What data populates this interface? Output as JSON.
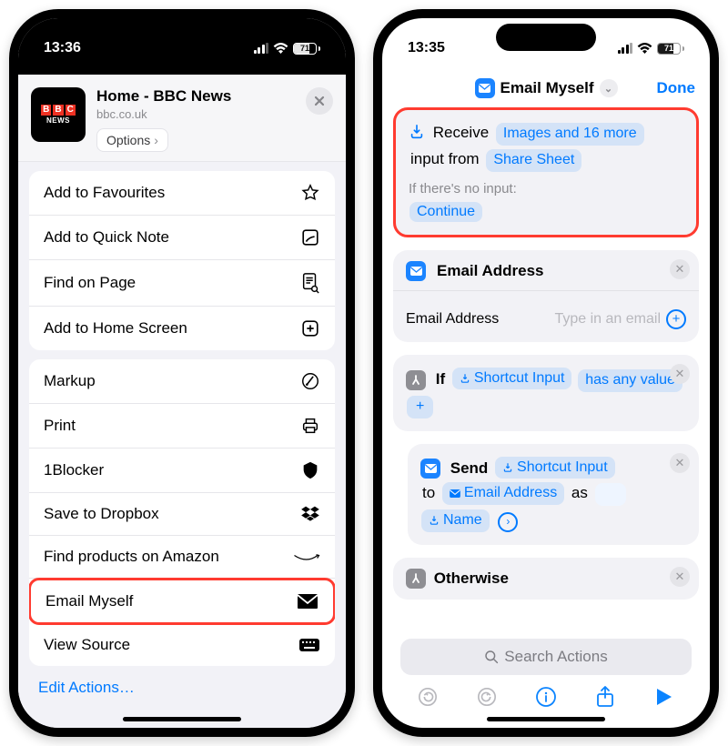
{
  "left": {
    "status": {
      "time": "13:36",
      "battery": "71"
    },
    "share": {
      "title": "Home - BBC News",
      "subtitle": "bbc.co.uk",
      "favicon_brand": "BBC",
      "favicon_sub": "NEWS",
      "options_label": "Options",
      "sections": [
        {
          "items": [
            {
              "label": "Add to Favourites",
              "icon": "star-icon"
            },
            {
              "label": "Add to Quick Note",
              "icon": "quicknote-icon"
            },
            {
              "label": "Find on Page",
              "icon": "find-icon"
            },
            {
              "label": "Add to Home Screen",
              "icon": "add-home-icon"
            }
          ]
        },
        {
          "items": [
            {
              "label": "Markup",
              "icon": "markup-icon"
            },
            {
              "label": "Print",
              "icon": "print-icon"
            },
            {
              "label": "1Blocker",
              "icon": "blocker-icon"
            },
            {
              "label": "Save to Dropbox",
              "icon": "dropbox-icon"
            },
            {
              "label": "Find products on Amazon",
              "icon": "amazon-icon"
            },
            {
              "label": "Email Myself",
              "icon": "mail-icon",
              "highlight": true
            },
            {
              "label": "View Source",
              "icon": "keyboard-icon"
            }
          ]
        }
      ],
      "edit_actions_label": "Edit Actions…"
    }
  },
  "right": {
    "status": {
      "time": "13:35",
      "battery": "71"
    },
    "nav": {
      "title": "Email Myself",
      "done": "Done"
    },
    "receive": {
      "word_receive": "Receive",
      "token_types": "Images and 16 more",
      "word_input_from": "input from",
      "token_source": "Share Sheet",
      "no_input_label": "If there's no input:",
      "no_input_action": "Continue"
    },
    "email_block": {
      "title": "Email Address",
      "field_label": "Email Address",
      "placeholder": "Type in an email"
    },
    "if_block": {
      "word_if": "If",
      "token_input": "Shortcut Input",
      "token_cond": "has any value"
    },
    "send_block": {
      "word_send": "Send",
      "token_input": "Shortcut Input",
      "word_to": "to",
      "token_to": "Email Address",
      "word_as": "as",
      "token_as": "Name"
    },
    "otherwise_label": "Otherwise",
    "search_placeholder": "Search Actions"
  }
}
